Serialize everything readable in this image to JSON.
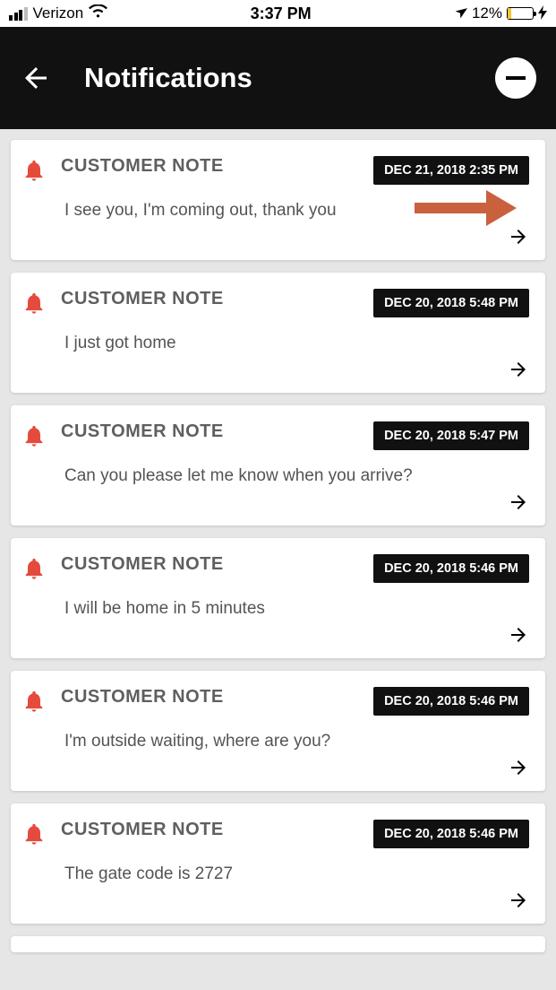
{
  "status": {
    "carrier": "Verizon",
    "time": "3:37 PM",
    "battery_pct": "12%"
  },
  "header": {
    "title": "Notifications"
  },
  "annotation": {
    "arrow_color": "#c9603e"
  },
  "notifications": [
    {
      "label": "CUSTOMER NOTE",
      "timestamp": "DEC 21, 2018 2:35 PM",
      "message": "I see you, I'm coming out, thank you",
      "highlight_arrow": true
    },
    {
      "label": "CUSTOMER NOTE",
      "timestamp": "DEC 20, 2018 5:48 PM",
      "message": "I just got home"
    },
    {
      "label": "CUSTOMER NOTE",
      "timestamp": "DEC 20, 2018 5:47 PM",
      "message": "Can you please let me know when you arrive?"
    },
    {
      "label": "CUSTOMER NOTE",
      "timestamp": "DEC 20, 2018 5:46 PM",
      "message": "I will be home in 5 minutes"
    },
    {
      "label": "CUSTOMER NOTE",
      "timestamp": "DEC 20, 2018 5:46 PM",
      "message": "I'm outside waiting, where are you?"
    },
    {
      "label": "CUSTOMER NOTE",
      "timestamp": "DEC 20, 2018 5:46 PM",
      "message": "The gate code is 2727"
    }
  ]
}
